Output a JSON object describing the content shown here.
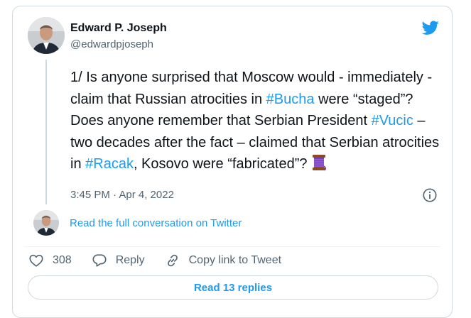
{
  "author": {
    "name": "Edward P. Joseph",
    "handle": "@edwardpjoseph"
  },
  "tweet": {
    "segments": [
      {
        "text": "1/ Is anyone surprised that Moscow would - immediately - claim that Russian atrocities in ",
        "type": "text"
      },
      {
        "text": "#Bucha",
        "type": "hashtag"
      },
      {
        "text": " were “staged”? Does anyone remember that Serbian President ",
        "type": "text"
      },
      {
        "text": "#Vucic",
        "type": "hashtag"
      },
      {
        "text": " – two decades after the fact – claimed that Serbian atrocities in ",
        "type": "text"
      },
      {
        "text": "#Racak",
        "type": "hashtag"
      },
      {
        "text": ", Kosovo were “fabricated”? ",
        "type": "text"
      }
    ],
    "trailing_emoji": "spool-of-thread",
    "timestamp": "3:45 PM · Apr 4, 2022"
  },
  "conversation_link": "Read the full conversation on Twitter",
  "actions": {
    "like_count": "308",
    "reply_label": "Reply",
    "copy_link_label": "Copy link to Tweet"
  },
  "read_replies_label": "Read 13 replies",
  "colors": {
    "accent": "#1d9bf0",
    "text": "#0f1419",
    "secondary": "#536471",
    "border": "#cfd9de"
  }
}
